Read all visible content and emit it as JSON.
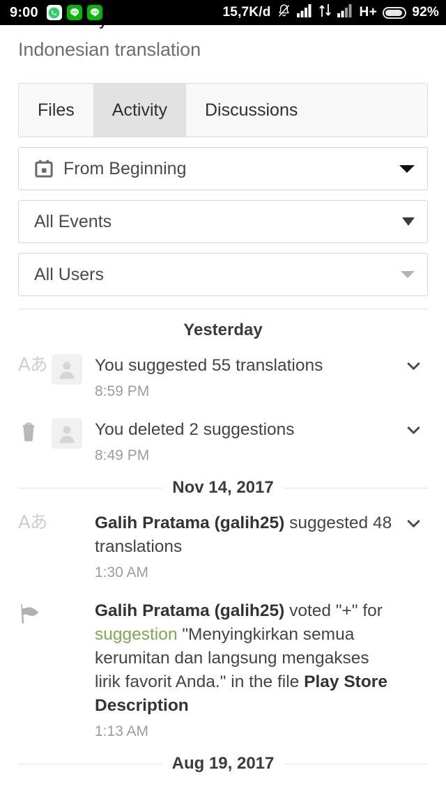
{
  "status_bar": {
    "time": "9:00",
    "left_app_icons": [
      "whatsapp-icon",
      "line-icon",
      "line-icon"
    ],
    "data_rate": "15,7K/d",
    "icons": [
      "bell-muted-icon",
      "signal-bars-icon",
      "data-transfer-icon",
      "signal-bars-icon"
    ],
    "network_type": "H+",
    "battery_percent": "92%",
    "battery_level": 92
  },
  "header": {
    "title": "Indonesian translation"
  },
  "tabs": [
    {
      "label": "Files",
      "active": false
    },
    {
      "label": "Activity",
      "active": true
    },
    {
      "label": "Discussions",
      "active": false
    }
  ],
  "filters": [
    {
      "name": "date-range",
      "value": "From Beginning",
      "icon": "calendar-icon",
      "caret": "wide"
    },
    {
      "name": "event-type",
      "value": "All Events",
      "icon": null,
      "caret": "narrow"
    },
    {
      "name": "user",
      "value": "All Users",
      "icon": null,
      "caret": "light"
    }
  ],
  "activity": {
    "groups": [
      {
        "label": "Yesterday",
        "style": "plain",
        "events": [
          {
            "icon": "translate-icon",
            "has_avatar": true,
            "text_html": "You suggested 55 translations",
            "time": "8:59 PM",
            "expandable": true
          },
          {
            "icon": "trash-icon",
            "has_avatar": true,
            "text_html": "You deleted 2 suggestions",
            "time": "8:49 PM",
            "expandable": true
          }
        ]
      },
      {
        "label": "Nov 14, 2017",
        "style": "rule",
        "events": [
          {
            "icon": "translate-icon",
            "has_avatar": false,
            "text_html": "<b>Galih Pratama (galih25)</b> suggested 48 translations",
            "time": "1:30 AM",
            "expandable": true
          },
          {
            "icon": "flag-icon",
            "has_avatar": false,
            "text_html": "<b>Galih Pratama (galih25)</b> voted \"+\" for <span class=\"link\">suggestion</span> \"Menyingkirkan semua kerumitan dan langsung mengakses lirik favorit Anda.\" in the file <b>Play Store Description</b>",
            "time": "1:13 AM",
            "expandable": false
          }
        ]
      },
      {
        "label": "Aug 19, 2017",
        "style": "rule",
        "events": []
      }
    ]
  },
  "colors": {
    "link_green": "#7bab4c",
    "status_bar_bg": "#000000",
    "active_tab_bg": "#e2e2e2",
    "line_app_green": "#00b900"
  }
}
